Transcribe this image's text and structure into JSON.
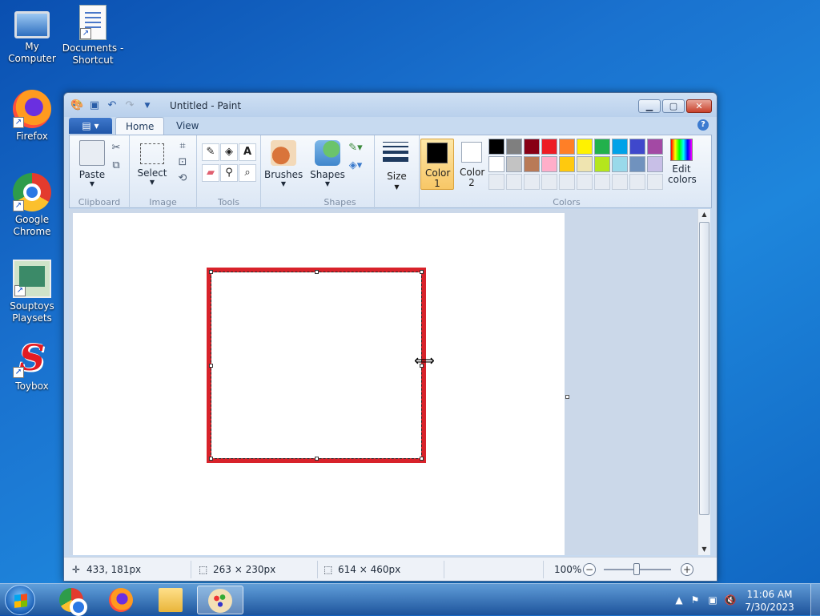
{
  "desktop": {
    "icons": [
      {
        "label": "My Computer",
        "icon": "computer-icon"
      },
      {
        "label": "Documents - Shortcut",
        "icon": "documents-icon"
      },
      {
        "label": "Firefox",
        "icon": "firefox-icon"
      },
      {
        "label": "Google Chrome",
        "icon": "chrome-icon"
      },
      {
        "label": "Souptoys Playsets",
        "icon": "souptoys-icon"
      },
      {
        "label": "Toybox",
        "icon": "toybox-icon"
      }
    ]
  },
  "window": {
    "title": "Untitled - Paint",
    "controls": {
      "minimize": "▁",
      "maximize": "▢",
      "close": "✕"
    }
  },
  "ribbon": {
    "tabs": [
      {
        "label": "Home",
        "active": true
      },
      {
        "label": "View",
        "active": false
      }
    ],
    "groups": {
      "clipboard": {
        "label": "Clipboard",
        "paste": "Paste"
      },
      "image": {
        "label": "Image",
        "select": "Select"
      },
      "tools": {
        "label": "Tools"
      },
      "shapes": {
        "label": "Shapes",
        "brushes": "Brushes",
        "shapes": "Shapes"
      },
      "size": {
        "label": "Size"
      },
      "colors": {
        "label": "Colors",
        "color1": {
          "label": "Color 1",
          "value": "#000000"
        },
        "color2": {
          "label": "Color 2",
          "value": "#ffffff"
        },
        "edit": "Edit colors",
        "palette_row1": [
          "#000000",
          "#7f7f7f",
          "#880015",
          "#ed1c24",
          "#ff7f27",
          "#fff200",
          "#22b14c",
          "#00a2e8",
          "#3f48cc",
          "#a349a4"
        ],
        "palette_row2": [
          "#ffffff",
          "#c3c3c3",
          "#b97a57",
          "#ffaec9",
          "#ffc90e",
          "#efe4b0",
          "#b5e61d",
          "#99d9ea",
          "#7092be",
          "#c8bfe7"
        ]
      }
    }
  },
  "canvas": {
    "shape_stroke_color": "#d8222a"
  },
  "status": {
    "cursor_pos": "433, 181px",
    "selection_size": "263 × 230px",
    "image_size": "614 × 460px",
    "zoom": "100%"
  },
  "taskbar": {
    "apps": [
      "chrome-icon",
      "firefox-icon",
      "explorer-icon",
      "paint-icon"
    ],
    "time": "11:06 AM",
    "date": "7/30/2023"
  }
}
